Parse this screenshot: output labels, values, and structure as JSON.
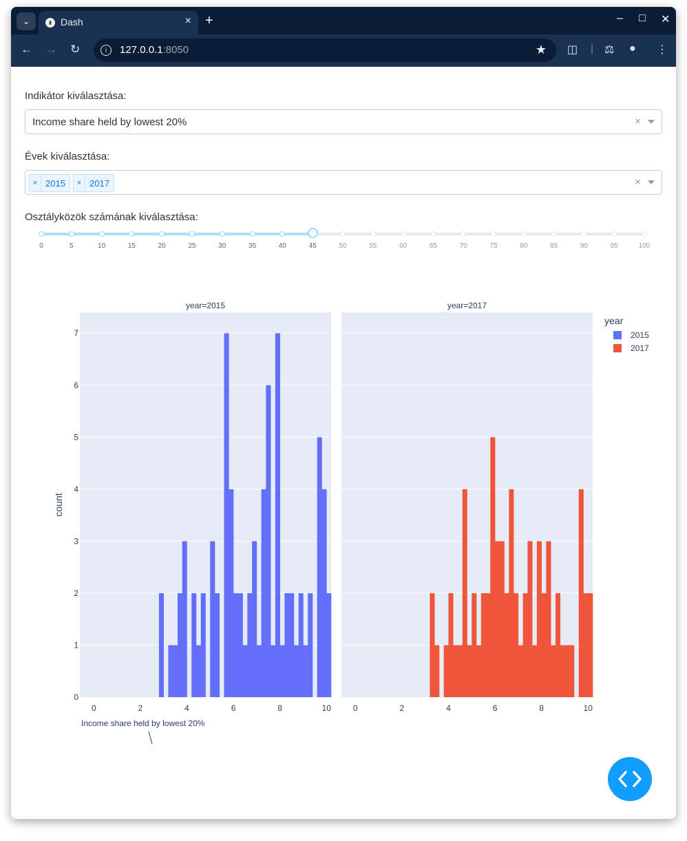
{
  "browser": {
    "tab_title": "Dash",
    "url_host": "127.0.0.1",
    "url_port": ":8050"
  },
  "form": {
    "indicator_label": "Indikátor kiválasztása:",
    "indicator_value": "Income share held by lowest 20%",
    "years_label": "Évek kiválasztása:",
    "years_selected": [
      "2015",
      "2017"
    ],
    "bins_label": "Osztályközök számának kiválasztása:",
    "bins_value": 45,
    "slider_marks": [
      "0",
      "5",
      "10",
      "15",
      "20",
      "25",
      "30",
      "35",
      "40",
      "45",
      "50",
      "55",
      "60",
      "65",
      "70",
      "75",
      "80",
      "85",
      "90",
      "95",
      "100"
    ]
  },
  "colors": {
    "series_2015": "#636efa",
    "series_2017": "#ef553b",
    "plot_bg": "#e5ecf6",
    "fab": "#119dff"
  },
  "icons": {
    "fab": "code-brackets-icon"
  },
  "chart_data": {
    "type": "bar",
    "title": "",
    "ylabel": "count",
    "xlabel": "Income share held by lowest 20%",
    "xlim": [
      -0.6,
      10.2
    ],
    "ylim": [
      0,
      7.4
    ],
    "x_ticks": [
      0,
      2,
      4,
      6,
      8,
      10
    ],
    "y_ticks": [
      0,
      1,
      2,
      3,
      4,
      5,
      6,
      7
    ],
    "bin_width": 0.2,
    "legend_title": "year",
    "legend_position": "top-right",
    "facets": [
      {
        "title": "year=2015",
        "series": "2015",
        "bin_starts": [
          2.8,
          3.0,
          3.2,
          3.4,
          3.6,
          3.8,
          4.0,
          4.2,
          4.4,
          4.6,
          4.8,
          5.0,
          5.2,
          5.4,
          5.6,
          5.8,
          6.0,
          6.2,
          6.4,
          6.6,
          6.8,
          7.0,
          7.2,
          7.4,
          7.6,
          7.8,
          8.0,
          8.2,
          8.4,
          8.6,
          8.8,
          9.0,
          9.2,
          9.4,
          9.6,
          9.8,
          10.0
        ],
        "counts": [
          2,
          0,
          1,
          1,
          2,
          3,
          0,
          2,
          1,
          2,
          0,
          3,
          2,
          0,
          7,
          4,
          2,
          2,
          1,
          2,
          3,
          1,
          4,
          6,
          1,
          7,
          1,
          2,
          2,
          1,
          2,
          1,
          2,
          0,
          5,
          4,
          2
        ]
      },
      {
        "title": "year=2017",
        "series": "2017",
        "bin_starts": [
          3.2,
          3.4,
          3.6,
          3.8,
          4.0,
          4.2,
          4.4,
          4.6,
          4.8,
          5.0,
          5.2,
          5.4,
          5.6,
          5.8,
          6.0,
          6.2,
          6.4,
          6.6,
          6.8,
          7.0,
          7.2,
          7.4,
          7.6,
          7.8,
          8.0,
          8.2,
          8.4,
          8.6,
          8.8,
          9.0,
          9.2,
          9.4,
          9.6,
          9.8,
          10.0
        ],
        "counts": [
          2,
          1,
          0,
          1,
          2,
          1,
          1,
          4,
          1,
          2,
          1,
          2,
          2,
          5,
          3,
          3,
          2,
          4,
          2,
          1,
          2,
          3,
          1,
          3,
          2,
          3,
          1,
          2,
          1,
          1,
          1,
          0,
          4,
          2,
          2
        ]
      }
    ]
  },
  "legend": {
    "title": "year",
    "items": [
      "2015",
      "2017"
    ]
  }
}
